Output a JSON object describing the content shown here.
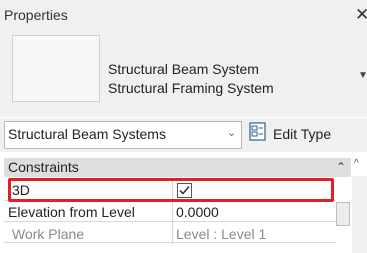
{
  "panel": {
    "title": "Properties"
  },
  "type_selector": {
    "family": "Structural Beam System",
    "type": "Structural Framing System"
  },
  "combo": {
    "value": "Structural Beam Systems",
    "edit_type_label": "Edit Type"
  },
  "grid": {
    "category": "Constraints",
    "rows": [
      {
        "label": "3D",
        "value_checked": true
      },
      {
        "label": "Elevation from Level",
        "value": "0.0000"
      },
      {
        "label": "Work Plane",
        "value": "Level : Level 1"
      }
    ]
  },
  "colors": {
    "highlight": "#e02027",
    "panel_bg": "#f0f0f0",
    "category_bg": "#dedede",
    "disabled_text": "#8a8a8a"
  },
  "icons": [
    "close-icon",
    "dropdown-arrow-icon",
    "edit-type-icon",
    "collapse-icon",
    "scroll-up-icon",
    "checkbox-icon"
  ]
}
